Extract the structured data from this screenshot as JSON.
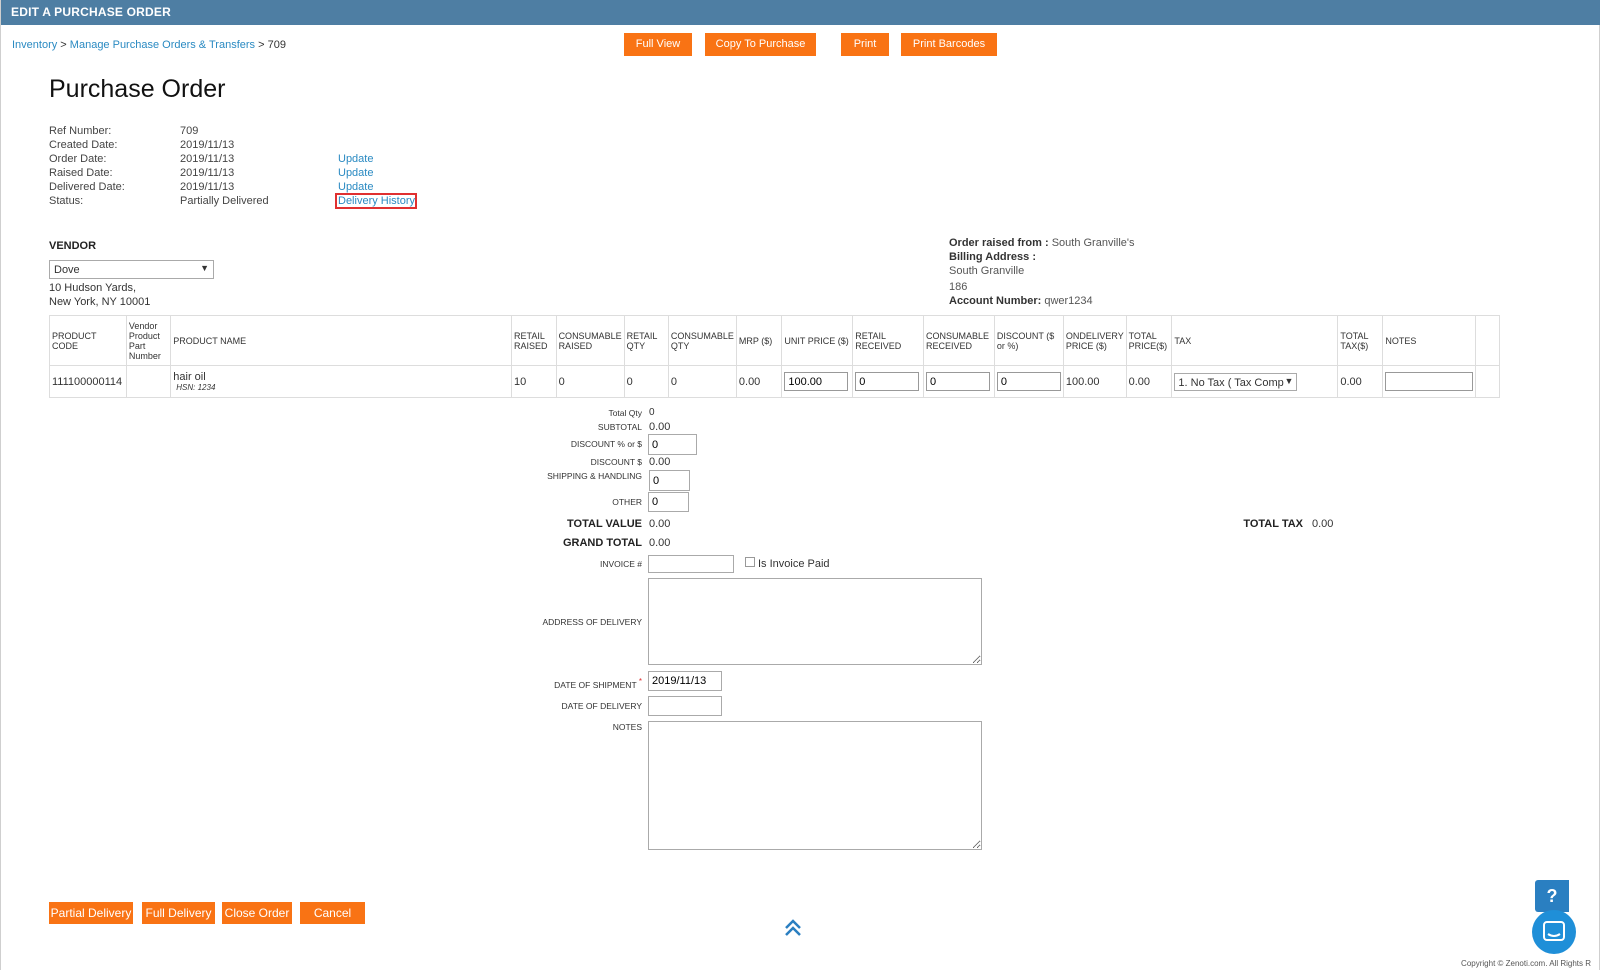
{
  "header": {
    "title": "EDIT A PURCHASE ORDER"
  },
  "breadcrumb": {
    "inventory": "Inventory",
    "sep1": " > ",
    "manage": "Manage Purchase Orders & Transfers",
    "sep2": " > ",
    "current": "709"
  },
  "toolbar": {
    "full_view": "Full View",
    "copy_to_purchase": "Copy To Purchase",
    "print": "Print",
    "print_barcodes": "Print Barcodes"
  },
  "page_title": "Purchase Order",
  "info": {
    "ref_label": "Ref Number:",
    "ref_value": "709",
    "created_label": "Created Date:",
    "created_value": "2019/11/13",
    "order_label": "Order Date:",
    "order_value": "2019/11/13",
    "order_link": "Update",
    "raised_label": "Raised Date:",
    "raised_value": "2019/11/13",
    "raised_link": "Update",
    "delivered_label": "Delivered Date:",
    "delivered_value": "2019/11/13",
    "delivered_link": "Update",
    "status_label": "Status:",
    "status_value": "Partially Delivered",
    "status_link": "Delivery History"
  },
  "vendor": {
    "heading": "VENDOR",
    "selected": "Dove",
    "address_line1": "10 Hudson Yards,",
    "address_line2": "New York, NY 10001"
  },
  "order_meta": {
    "raised_from_label": "Order raised from :",
    "raised_from_value": "South Granville's",
    "billing_label": "Billing Address :",
    "billing_line1": "South Granville",
    "billing_line2": "186",
    "account_label": "Account Number:",
    "account_value": "qwer1234"
  },
  "table": {
    "headers": [
      "PRODUCT CODE",
      "Vendor Product Part Number",
      "PRODUCT NAME",
      "RETAIL RAISED",
      "CONSUMABLE RAISED",
      "RETAIL QTY",
      "CONSUMABLE QTY",
      "MRP ($)",
      "UNIT PRICE ($)",
      "RETAIL RECEIVED",
      "CONSUMABLE RECEIVED",
      "DISCOUNT ($ or %)",
      "ONDELIVERY PRICE ($)",
      "TOTAL PRICE($)",
      "TAX",
      "TOTAL TAX($)",
      "NOTES"
    ],
    "row": {
      "product_code": "111100000114",
      "vendor_part": "",
      "product_name": "hair oil",
      "hsn": "HSN: 1234",
      "retail_raised": "10",
      "consumable_raised": "0",
      "retail_qty": "0",
      "consumable_qty": "0",
      "mrp": "0.00",
      "unit_price": "100.00",
      "retail_received": "0",
      "consumable_received": "0",
      "discount": "0",
      "ondelivery_price": "100.00",
      "total_price": "0.00",
      "tax": "1. No Tax ( Tax Comp",
      "total_tax": "0.00",
      "notes": ""
    }
  },
  "summary": {
    "total_qty_label": "Total Qty",
    "total_qty_value": "0",
    "subtotal_label": "SUBTOTAL",
    "subtotal_value": "0.00",
    "discount_pct_label": "DISCOUNT % or $",
    "discount_pct_value": "0",
    "discount_label": "DISCOUNT $",
    "discount_value": "0.00",
    "shipping_label": "SHIPPING & HANDLING",
    "shipping_value": "0",
    "other_label": "OTHER",
    "other_value": "0",
    "total_value_label": "TOTAL VALUE",
    "total_value": "0.00",
    "total_tax_label": "TOTAL TAX",
    "total_tax": "0.00",
    "grand_total_label": "GRAND TOTAL",
    "grand_total": "0.00",
    "invoice_label": "INVOICE #",
    "invoice_value": "",
    "invoice_paid_label": "Is Invoice Paid",
    "address_label": "ADDRESS OF DELIVERY",
    "shipment_label": "DATE OF SHIPMENT",
    "required_mark": "*",
    "shipment_value": "2019/11/13",
    "delivery_label": "DATE OF DELIVERY",
    "delivery_value": "",
    "notes_label": "NOTES"
  },
  "actions": {
    "partial": "Partial Delivery",
    "full": "Full Delivery",
    "close": "Close Order",
    "cancel": "Cancel"
  },
  "footer": {
    "copyright": "Copyright © Zenoti.com. All Rights R",
    "help": "?"
  },
  "colors": {
    "header_bg": "#4e7ea3",
    "button_orange": "#f97314",
    "link_blue": "#2a8ac2",
    "highlight_red": "#e03030"
  }
}
